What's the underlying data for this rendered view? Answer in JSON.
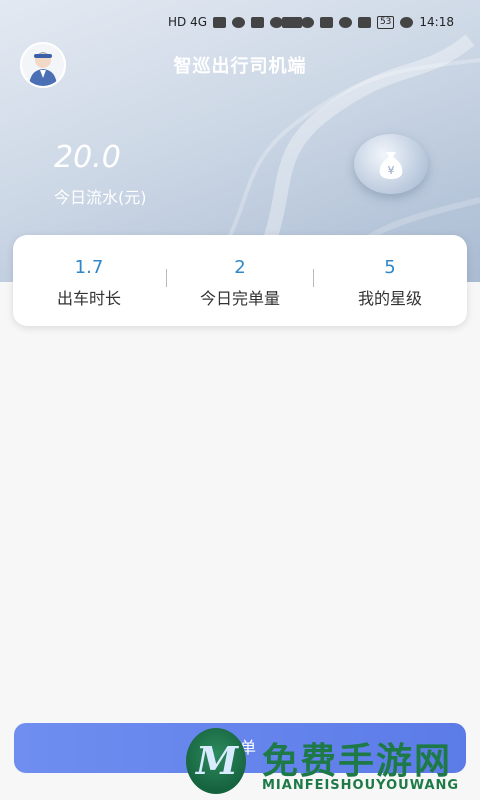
{
  "status_bar": {
    "network": "HD 4G",
    "battery": "53",
    "time": "14:18"
  },
  "header": {
    "title": "智巡出行司机端"
  },
  "revenue": {
    "value": "20.0",
    "label": "今日流水(元)"
  },
  "stats": [
    {
      "value": "1.7",
      "label": "出车时长"
    },
    {
      "value": "2",
      "label": "今日完单量"
    },
    {
      "value": "5",
      "label": "我的星级"
    }
  ],
  "bottom_button": {
    "label": "接单"
  },
  "watermark": {
    "cn": "免费手游网",
    "en": "MIANFEISHOUYOUWANG",
    "logo_letter": "M"
  },
  "colors": {
    "stat_value": "#2f86c8",
    "button": "#6f8ef0"
  }
}
